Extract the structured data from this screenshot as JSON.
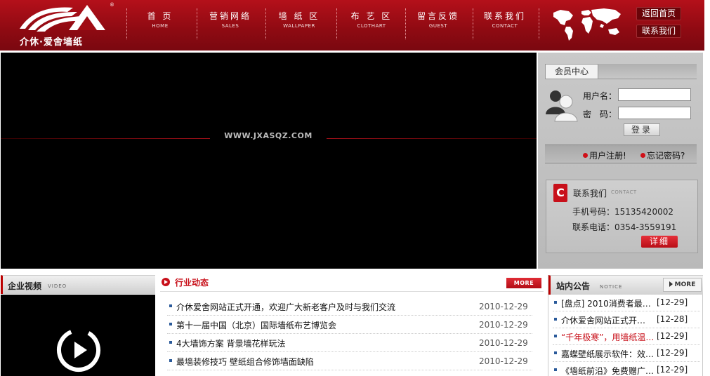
{
  "header": {
    "logo_text": "介休·爱舍墙纸",
    "registered_mark": "®",
    "nav": [
      {
        "cn": "首  页",
        "en": "HOME"
      },
      {
        "cn": "营销网络",
        "en": "SALES"
      },
      {
        "cn": "墙 纸 区",
        "en": "WALLPAPER"
      },
      {
        "cn": "布 艺 区",
        "en": "CLOTHART"
      },
      {
        "cn": "留言反馈",
        "en": "GUEST"
      },
      {
        "cn": "联系我们",
        "en": "CONTACT"
      }
    ],
    "back_home": "返回首页",
    "contact_us": "联系我们"
  },
  "banner": {
    "url_text": "WWW.JXASQZ.COM"
  },
  "member": {
    "tab": "会员中心",
    "username_label": "用户名：",
    "password_label": "密　码：",
    "login": "登录",
    "register": "用户注册!",
    "forgot": "忘记密码?",
    "contact_title": "联系我们",
    "contact_en": "CONTACT",
    "mobile": "手机号码：15135420002",
    "phone": "联系电话：0354-3559191",
    "detail": "详细"
  },
  "video": {
    "title": "企业视频",
    "en": "VIDEO"
  },
  "news": {
    "title": "行业动态",
    "more": "MORE",
    "items": [
      {
        "title": "介休爱舍网站正式开通，欢迎广大新老客户及时与我们交流",
        "date": "2010-12-29"
      },
      {
        "title": "第十一届中国（北京）国际墙纸布艺博览会",
        "date": "2010-12-29"
      },
      {
        "title": "4大墙饰方案 背景墙花样玩法",
        "date": "2010-12-29"
      },
      {
        "title": "最墙装修技巧 壁纸组合修饰墙面缺陷",
        "date": "2010-12-29"
      }
    ]
  },
  "notice": {
    "title": "站内公告",
    "en": "NOTICE",
    "more": "MORE",
    "items": [
      {
        "title": "[盘点] 2010消费者最…",
        "date": "[12-29]",
        "red": false
      },
      {
        "title": "介休爱舍网站正式开…",
        "date": "[12-28]",
        "red": false
      },
      {
        "title": "“千年极寒”，用墙纸温…",
        "date": "[12-29]",
        "red": true
      },
      {
        "title": "嘉蝶壁纸展示软件：效…",
        "date": "[12-29]",
        "red": false
      },
      {
        "title": "《墙纸前沿》免费赠广…",
        "date": "[12-29]",
        "red": false
      }
    ]
  },
  "colors": {
    "brand_red": "#a00c14",
    "accent_red": "#c8101a"
  }
}
